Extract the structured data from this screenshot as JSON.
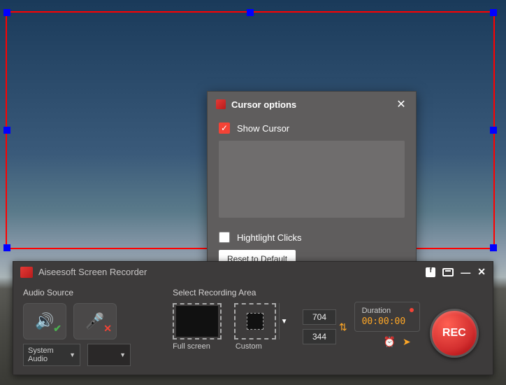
{
  "dialog": {
    "title": "Cursor options",
    "show_cursor_label": "Show Cursor",
    "highlight_clicks_label": "Hightlight Clicks",
    "reset_label": "Reset to Default"
  },
  "toolbar": {
    "title": "Aiseesoft Screen Recorder",
    "audio_label": "Audio Source",
    "area_label": "Select Recording Area",
    "system_audio_label": "System Audio",
    "full_screen_label": "Full screen",
    "custom_label": "Custom",
    "width": "704",
    "height": "344",
    "duration_label": "Duration",
    "duration_value": "00:00:00",
    "rec_label": "REC"
  }
}
